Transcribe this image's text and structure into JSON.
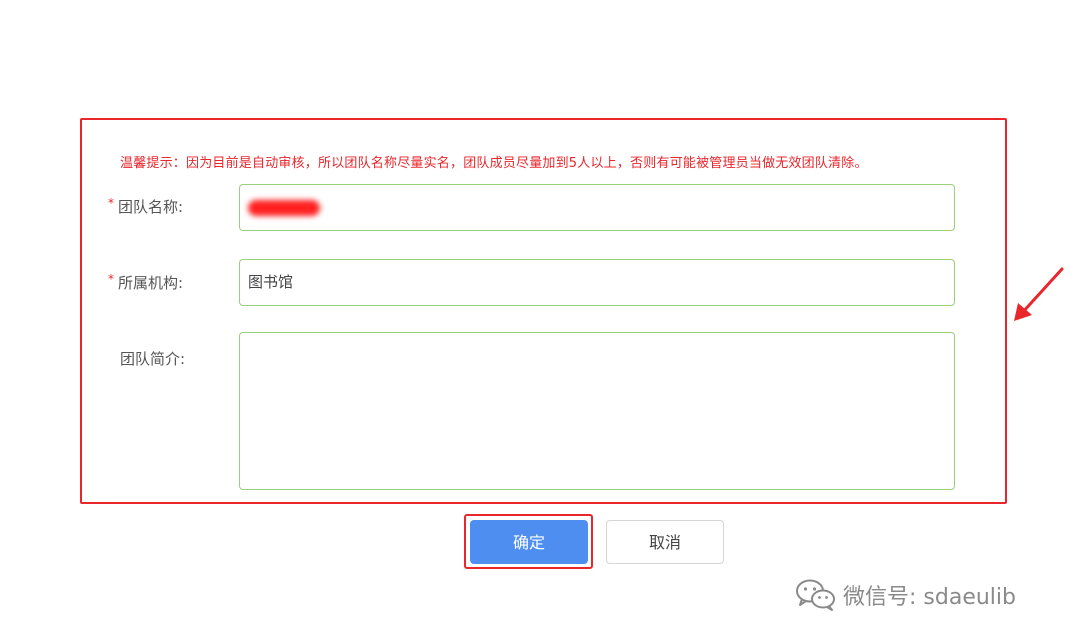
{
  "form": {
    "notice": "温馨提示：因为目前是自动审核，所以团队名称尽量实名，团队成员尽量加到5人以上，否则有可能被管理员当做无效团队清除。",
    "required_mark": "*",
    "team_name": {
      "label": "团队名称:"
    },
    "organization": {
      "label": "所属机构:",
      "value": "图书馆"
    },
    "description": {
      "label": "团队简介:",
      "value": ""
    }
  },
  "buttons": {
    "confirm": "确定",
    "cancel": "取消"
  },
  "watermark": {
    "text": "微信号: sdaeulib",
    "icon": "wechat-icon"
  },
  "colors": {
    "highlight": "#e8262b",
    "primary": "#4e8ef0",
    "field_border": "#9ad07a"
  }
}
